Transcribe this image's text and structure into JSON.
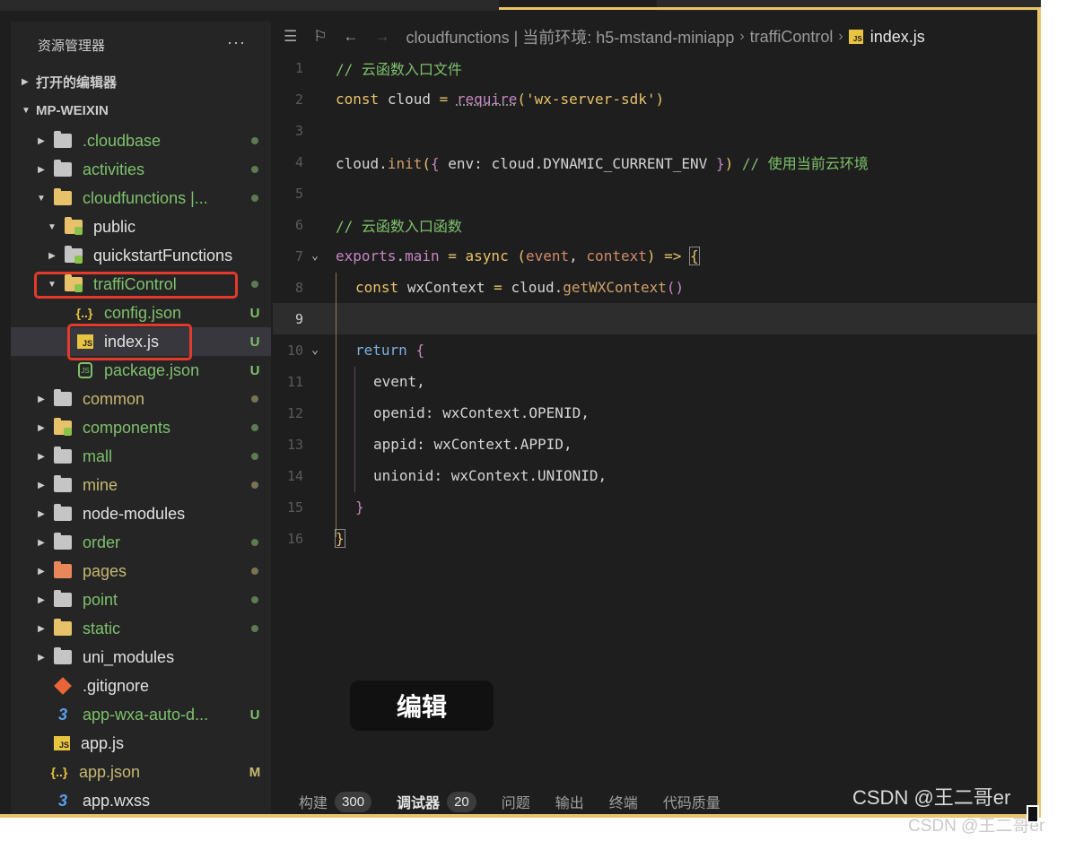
{
  "sidebar": {
    "title": "资源管理器",
    "more": "···",
    "open_editors": "打开的编辑器",
    "project": "MP-WEIXIN",
    "tree": [
      {
        "name": ".cloudbase",
        "status": "",
        "chev": "▸"
      },
      {
        "name": "activities",
        "status": "",
        "chev": "▸"
      },
      {
        "name": "cloudfunctions |...",
        "status": "",
        "chev": "▾"
      },
      {
        "name": "public",
        "status": "",
        "chev": "▾"
      },
      {
        "name": "quickstartFunctions",
        "status": "",
        "chev": "▸"
      },
      {
        "name": "traffiControl",
        "status": "",
        "chev": "▾"
      },
      {
        "name": "config.json",
        "status": "U",
        "icon_text": "{..}"
      },
      {
        "name": "index.js",
        "status": "U",
        "icon_text": "JS"
      },
      {
        "name": "package.json",
        "status": "U",
        "icon_text": "JS"
      },
      {
        "name": "common",
        "status": "",
        "chev": "▸"
      },
      {
        "name": "components",
        "status": "",
        "chev": "▸"
      },
      {
        "name": "mall",
        "status": "",
        "chev": "▸"
      },
      {
        "name": "mine",
        "status": "",
        "chev": "▸"
      },
      {
        "name": "node-modules",
        "status": "",
        "chev": "▸"
      },
      {
        "name": "order",
        "status": "",
        "chev": "▸"
      },
      {
        "name": "pages",
        "status": "",
        "chev": "▸"
      },
      {
        "name": "point",
        "status": "",
        "chev": "▸"
      },
      {
        "name": "static",
        "status": "",
        "chev": "▸"
      },
      {
        "name": "uni_modules",
        "status": "",
        "chev": "▸"
      },
      {
        "name": ".gitignore",
        "status": ""
      },
      {
        "name": "app-wxa-auto-d...",
        "status": "U",
        "icon_text": "3"
      },
      {
        "name": "app.js",
        "status": "",
        "icon_text": "JS"
      },
      {
        "name": "app.json",
        "status": "M",
        "icon_text": "{..}"
      },
      {
        "name": "app.wxss",
        "status": "",
        "icon_text": "3"
      }
    ]
  },
  "breadcrumb": {
    "path": "cloudfunctions | 当前环境: h5-mstand-miniapp",
    "folder": "traffiControl",
    "file": "index.js",
    "file_icon": "JS"
  },
  "code": {
    "line_numbers": [
      "1",
      "2",
      "3",
      "4",
      "5",
      "6",
      "7",
      "8",
      "9",
      "10",
      "11",
      "12",
      "13",
      "14",
      "15",
      "16"
    ],
    "l1": "// 云函数入口文件",
    "l2_kw": "const",
    "l2_id": "cloud",
    "l2_eq": "=",
    "l2_fn": "require",
    "l2_str": "'wx-server-sdk'",
    "l2_dots": "···",
    "l4_obj": "cloud",
    "l4_fn": "init",
    "l4_key": "env",
    "l4_val": "cloud.DYNAMIC_CURRENT_ENV",
    "l4_cmt": "// 使用当前云环境",
    "l6": "// 云函数入口函数",
    "l7_obj": "exports",
    "l7_prop": "main",
    "l7_kw": "async",
    "l7_p1": "event",
    "l7_p2": "context",
    "l7_arrow": "=>",
    "l8_kw": "const",
    "l8_id": "wxContext",
    "l8_obj": "cloud",
    "l8_fn": "getWXContext",
    "l10_kw": "return",
    "l11": "event,",
    "l12_key": "openid",
    "l12_val": "wxContext",
    "l12_prop": "OPENID",
    "l13_key": "appid",
    "l13_val": "wxContext",
    "l13_prop": "APPID",
    "l14_key": "unionid",
    "l14_val": "wxContext",
    "l14_prop": "UNIONID"
  },
  "edit_badge": "编辑",
  "panel": {
    "tabs": [
      {
        "label": "构建",
        "count": "300"
      },
      {
        "label": "调试器",
        "count": "20"
      },
      {
        "label": "问题"
      },
      {
        "label": "输出"
      },
      {
        "label": "终端"
      },
      {
        "label": "代码质量"
      }
    ]
  },
  "watermark": {
    "main": "CSDN @王二哥er",
    "shadow": "CSDN @王二哥er"
  },
  "colors": {
    "accent_border": "#e9c46a",
    "highlight_box": "#e33a2c",
    "git_untracked": "#7ec16b"
  }
}
